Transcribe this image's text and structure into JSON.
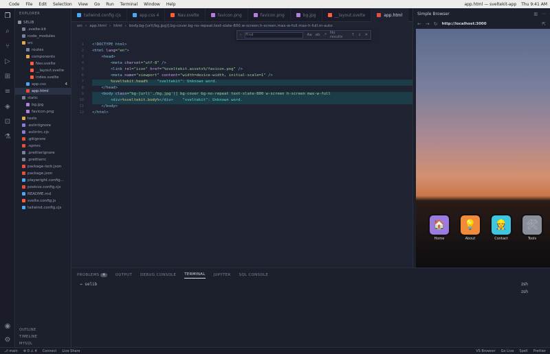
{
  "menubar": {
    "items": [
      "Code",
      "File",
      "Edit",
      "Selection",
      "View",
      "Go",
      "Run",
      "Terminal",
      "Window",
      "Help"
    ],
    "right": [
      "app.html — sveltekit-app",
      "Thu 9:41 AM"
    ]
  },
  "activity_icons": [
    "explorer-icon",
    "search-icon",
    "source-control-icon",
    "run-debug-icon",
    "extensions-icon",
    "database-icon",
    "docker-icon",
    "remote-icon",
    "test-icon",
    "accounts-icon",
    "settings-icon"
  ],
  "sidebar": {
    "header": "EXPLORER",
    "items": [
      {
        "label": "SELIB",
        "indent": 0,
        "color": "#8a91a5"
      },
      {
        "label": ".svelte-kit",
        "indent": 1,
        "color": "#7b8296"
      },
      {
        "label": "node_modules",
        "indent": 1,
        "color": "#7b8296"
      },
      {
        "label": "src",
        "indent": 1,
        "color": "#e0a84e"
      },
      {
        "label": "routes",
        "indent": 2,
        "color": "#7b8296"
      },
      {
        "label": "components",
        "indent": 2,
        "color": "#e0a84e"
      },
      {
        "label": "Nav.svelte",
        "indent": 3,
        "color": "#ff5c3a"
      },
      {
        "label": "__layout.svelte",
        "indent": 3,
        "color": "#ff5c3a"
      },
      {
        "label": "index.svelte",
        "indent": 3,
        "color": "#ff5c3a"
      },
      {
        "label": "app.css",
        "indent": 2,
        "color": "#4aa8f5",
        "badge": "4"
      },
      {
        "label": "app.html",
        "indent": 2,
        "color": "#e54e3a",
        "selected": true
      },
      {
        "label": "static",
        "indent": 1,
        "color": "#7b8296"
      },
      {
        "label": "bg.jpg",
        "indent": 2,
        "color": "#b57edc"
      },
      {
        "label": "favicon.png",
        "indent": 2,
        "color": "#b57edc"
      },
      {
        "label": "tests",
        "indent": 1,
        "color": "#e0a84e"
      },
      {
        "label": ".eslintignore",
        "indent": 1,
        "color": "#8b7bd8"
      },
      {
        "label": ".eslintrc.cjs",
        "indent": 1,
        "color": "#8b7bd8"
      },
      {
        "label": ".gitignore",
        "indent": 1,
        "color": "#e54e3a"
      },
      {
        "label": ".npmrc",
        "indent": 1,
        "color": "#e54e3a"
      },
      {
        "label": ".prettierignore",
        "indent": 1,
        "color": "#7b8296"
      },
      {
        "label": ".prettierrc",
        "indent": 1,
        "color": "#7b8296"
      },
      {
        "label": "package-lock.json",
        "indent": 1,
        "color": "#e54e3a"
      },
      {
        "label": "package.json",
        "indent": 1,
        "color": "#e54e3a"
      },
      {
        "label": "playwright.config...",
        "indent": 1,
        "color": "#4aa8f5"
      },
      {
        "label": "postcss.config.cjs",
        "indent": 1,
        "color": "#e54e3a"
      },
      {
        "label": "README.md",
        "indent": 1,
        "color": "#4aa8f5"
      },
      {
        "label": "svelte.config.js",
        "indent": 1,
        "color": "#ff5c3a"
      },
      {
        "label": "tailwind.config.cjs",
        "indent": 1,
        "color": "#4aa8f5"
      }
    ],
    "bottom": [
      "OUTLINE",
      "TIMELINE",
      "MYSQL"
    ]
  },
  "tabs": [
    {
      "label": "tailwind.config.cjs",
      "color": "#4aa8f5"
    },
    {
      "label": "app.css 4",
      "color": "#4aa8f5"
    },
    {
      "label": "Nav.svelte",
      "color": "#ff5c3a"
    },
    {
      "label": "favicon.png",
      "color": "#b57edc"
    },
    {
      "label": "favicon.png",
      "color": "#b57edc"
    },
    {
      "label": "bg.jpg",
      "color": "#b57edc"
    },
    {
      "label": "__layout.svelte",
      "color": "#ff5c3a"
    },
    {
      "label": "app.html",
      "color": "#e54e3a",
      "active": true
    }
  ],
  "breadcrumb": [
    "src",
    "app.html",
    "html",
    "body.bg-[url(/bg.jpg)].bg-cover.bg-no-repeat.text-slate-800.w-screen.h-screen.max-w-full.max-h-full.m-auto"
  ],
  "find": {
    "placeholder": "Find",
    "aa": "Aa",
    "ab": "ab",
    "re": ".*",
    "result": "No results"
  },
  "code": {
    "lines": [
      [
        {
          "t": "<!DOCTYPE html>",
          "c": "tag"
        }
      ],
      [
        {
          "t": "<html ",
          "c": "tag"
        },
        {
          "t": "lang",
          "c": "attr"
        },
        {
          "t": "=\"en\"",
          "c": "str"
        },
        {
          "t": ">",
          "c": "tag"
        }
      ],
      [
        {
          "t": "    <head>",
          "c": "tag"
        }
      ],
      [
        {
          "t": "        <meta ",
          "c": "tag"
        },
        {
          "t": "charset",
          "c": "attr"
        },
        {
          "t": "=\"utf-8\"",
          "c": "str"
        },
        {
          "t": " />",
          "c": "tag"
        }
      ],
      [
        {
          "t": "        <link ",
          "c": "tag"
        },
        {
          "t": "rel",
          "c": "attr"
        },
        {
          "t": "=\"icon\" ",
          "c": "str"
        },
        {
          "t": "href",
          "c": "attr"
        },
        {
          "t": "=\"%sveltekit.assets%/favicon.png\"",
          "c": "str"
        },
        {
          "t": " />",
          "c": "tag"
        }
      ],
      [
        {
          "t": "        <meta ",
          "c": "tag"
        },
        {
          "t": "name",
          "c": "attr"
        },
        {
          "t": "=\"viewport\" ",
          "c": "str"
        },
        {
          "t": "content",
          "c": "attr"
        },
        {
          "t": "=\"width=device-width, initial-scale=1\"",
          "c": "str"
        },
        {
          "t": " />",
          "c": "tag"
        }
      ],
      [
        {
          "t": "        %sveltekit.head%",
          "c": "kw"
        },
        {
          "t": "    \"sveltekit\": Unknown word.",
          "c": "diag"
        }
      ],
      [
        {
          "t": "    </head>",
          "c": "tag"
        }
      ],
      [
        {
          "t": "    <body ",
          "c": "tag"
        },
        {
          "t": "class",
          "c": "attr"
        },
        {
          "t": "=\"bg-[url('./bg.jpg')] bg-cover bg-no-repeat text-slate-800 w-screen h-screen max-w-full",
          "c": "str"
        }
      ],
      [
        {
          "t": "        <div>",
          "c": "tag"
        },
        {
          "t": "%sveltekit.body%",
          "c": "kw"
        },
        {
          "t": "</div>",
          "c": "tag"
        },
        {
          "t": "    \"sveltekit\": Unknown word.",
          "c": "diag"
        }
      ],
      [
        {
          "t": "    </body>",
          "c": "tag"
        }
      ],
      [
        {
          "t": "</html>",
          "c": "tag"
        }
      ]
    ]
  },
  "browser": {
    "title": "Simple Browser",
    "url": "http://localhost:3000",
    "apps": [
      {
        "label": "Home",
        "icon": "🏠",
        "color": "#9b7be0"
      },
      {
        "label": "About",
        "icon": "💡",
        "color": "#f28a3c"
      },
      {
        "label": "Contact",
        "icon": "👷",
        "color": "#3ec6e0"
      },
      {
        "label": "Tools",
        "icon": "🛠",
        "color": "#8b8f99"
      }
    ]
  },
  "panel": {
    "tabs": [
      "PROBLEMS",
      "OUTPUT",
      "DEBUG CONSOLE",
      "TERMINAL",
      "JUPYTER",
      "SQL CONSOLE"
    ],
    "problems_count": "4",
    "active_tab": "TERMINAL",
    "prompt": "→  selib",
    "shells": [
      "zsh",
      "zsh"
    ]
  },
  "status": {
    "left": [
      "⎇ main",
      "⊗ 0  ⚠ 4",
      "Connect",
      "Live Share"
    ],
    "right": [
      "VS Browser",
      "Go Live",
      "Spell",
      "Prettier"
    ]
  }
}
